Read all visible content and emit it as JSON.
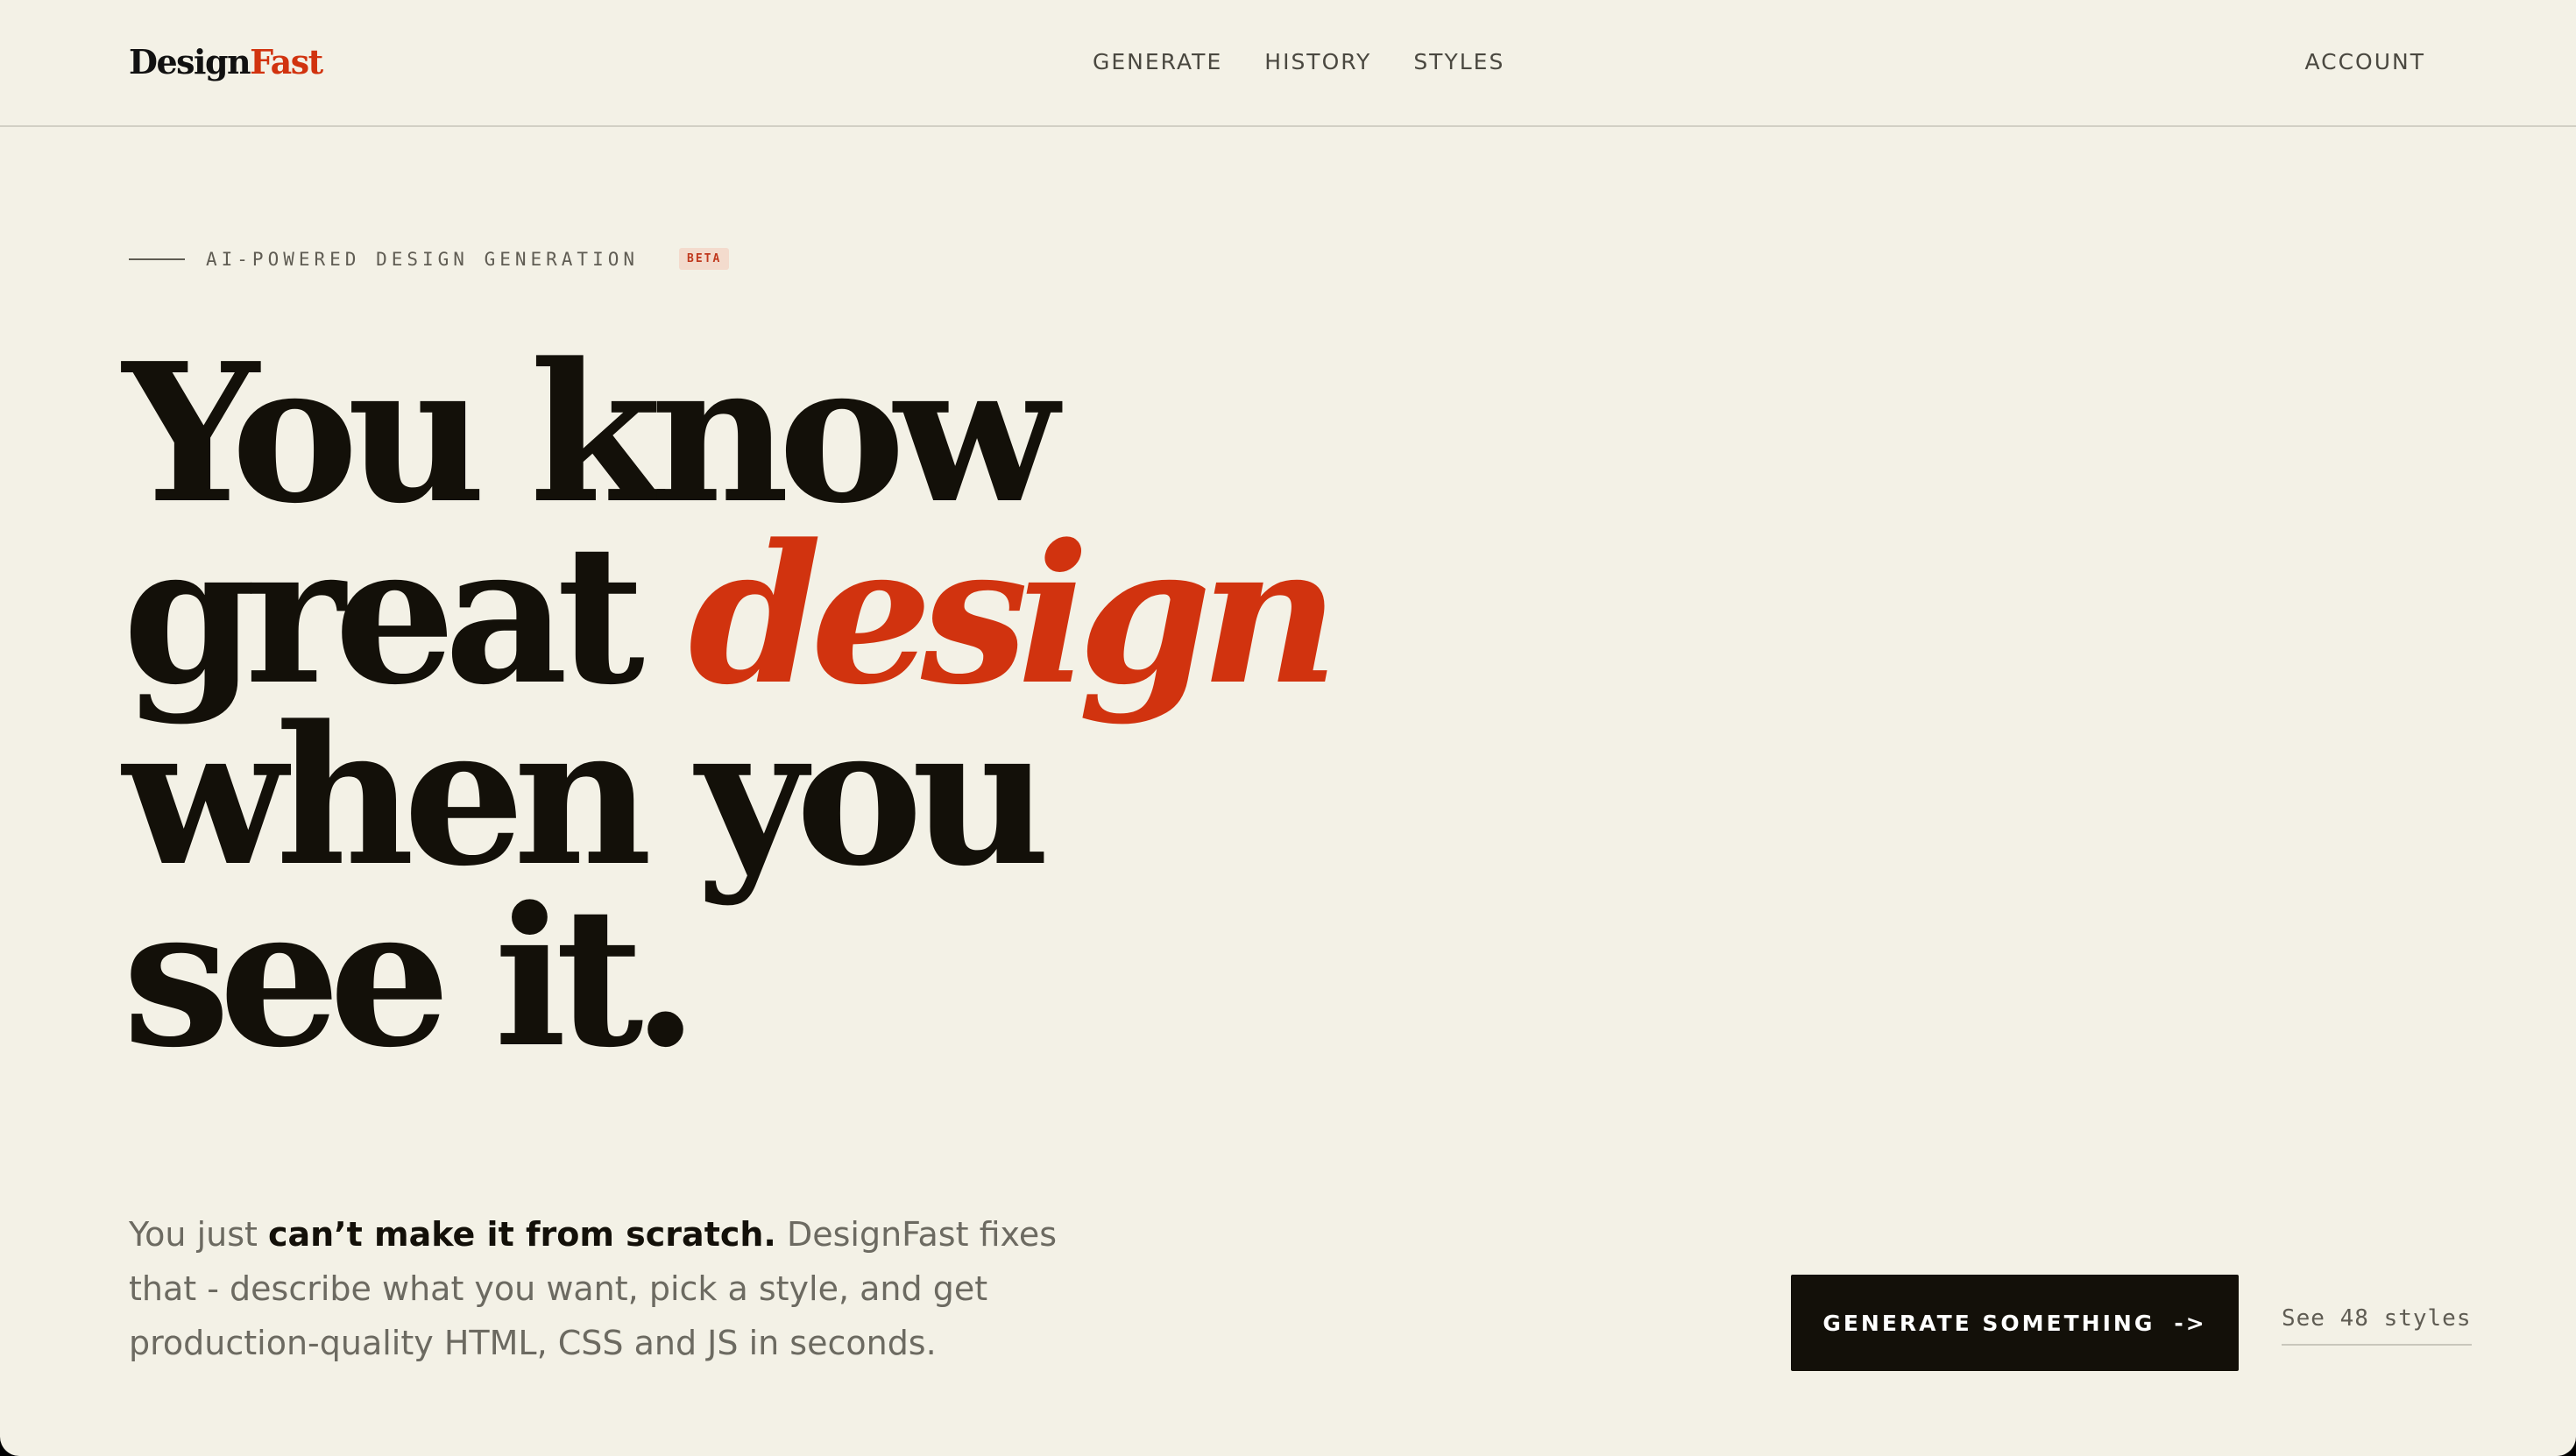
{
  "header": {
    "logo_main": "Design",
    "logo_accent": "Fast",
    "nav": [
      "GENERATE",
      "HISTORY",
      "STYLES"
    ],
    "account": "ACCOUNT"
  },
  "hero": {
    "eyebrow": "AI-POWERED DESIGN GENERATION",
    "badge": "BETA",
    "headline": {
      "line1": "You know",
      "line2_plain": "great ",
      "line2_accent": "design",
      "line3": "when you",
      "line4": "see it."
    },
    "description": {
      "pre": "You just ",
      "strong": "can’t make it from scratch.",
      "post": " DesignFast fixes that - describe what you want, pick a style, and get production-quality HTML, CSS and JS in seconds."
    },
    "cta_primary": "GENERATE SOMETHING",
    "cta_primary_arrow": "->",
    "cta_secondary": "See 48 styles"
  },
  "colors": {
    "background": "#f3f1e6",
    "text": "#131009",
    "accent": "#d1330f",
    "muted": "#6c6a61"
  }
}
